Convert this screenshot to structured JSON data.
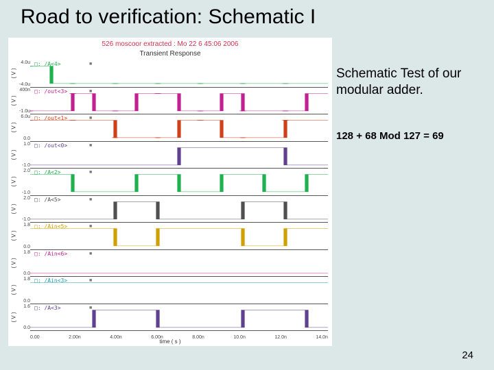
{
  "title": "Road to verification: Schematic I",
  "page_number": "24",
  "right": {
    "test_desc": "Schematic Test of our modular adder.",
    "equation": "128 + 68 Mod 127 = 69"
  },
  "plot": {
    "header": "526 moscoor extracted : Mo 22 6 45:06 2006",
    "subheader": "Transient Response",
    "xaxis_label": "time ( s )",
    "xticks": [
      "0.00",
      "2.00n",
      "4.00n",
      "6.00n",
      "8.00n",
      "10.0n",
      "12.0n",
      "14.0n"
    ],
    "ylabel_unit": "( V )",
    "traces": [
      {
        "name": "/A<4>",
        "color": "#20b050",
        "ytop": "4.0u",
        "ybot": "-4.0u",
        "levels": [
          1,
          0,
          0,
          0,
          0,
          0,
          0,
          0,
          0,
          0,
          0,
          0,
          0,
          0
        ],
        "dots": true
      },
      {
        "name": "/out<3>",
        "color": "#c02090",
        "ytop": "400n",
        "ybot": "-1.0u",
        "levels": [
          0,
          0,
          1,
          0,
          0,
          1,
          1,
          0,
          0,
          1,
          0,
          0,
          0,
          1
        ],
        "dots": true
      },
      {
        "name": "/out<1>",
        "color": "#d04018",
        "ytop": "6.0u",
        "ybot": "0.0",
        "levels": [
          1,
          1,
          1,
          1,
          0,
          0,
          0,
          1,
          1,
          0,
          0,
          0,
          1,
          1
        ],
        "dots": true
      },
      {
        "name": "/out<0>",
        "color": "#604090",
        "ytop": "1.0",
        "ybot": "-1.0",
        "levels": [
          0,
          0,
          0,
          0,
          0,
          0,
          0,
          1,
          1,
          1,
          1,
          1,
          0,
          0
        ],
        "dots": false
      },
      {
        "name": "/A<2>",
        "color": "#20b050",
        "ytop": "2.0",
        "ybot": "-1.0",
        "levels": [
          1,
          1,
          0,
          0,
          0,
          1,
          1,
          0,
          0,
          1,
          1,
          0,
          0,
          1
        ],
        "dots": false
      },
      {
        "name": "/A<5>",
        "color": "#505050",
        "ytop": "2.0",
        "ybot": "-1.0",
        "levels": [
          0,
          0,
          0,
          0,
          1,
          1,
          0,
          0,
          0,
          0,
          1,
          1,
          0,
          0
        ],
        "dots": false
      },
      {
        "name": "/Ain<5>",
        "color": "#d0a000",
        "ytop": "1.8",
        "ybot": "0.0",
        "levels": [
          1,
          1,
          1,
          1,
          0,
          0,
          1,
          1,
          1,
          1,
          0,
          0,
          1,
          1
        ],
        "dots": false
      },
      {
        "name": "/Ain<6>",
        "color": "#c02090",
        "ytop": "1.8",
        "ybot": "0.0",
        "levels": [
          0,
          0,
          0,
          0,
          0,
          0,
          0,
          0,
          0,
          0,
          0,
          0,
          0,
          0
        ],
        "dots": false
      },
      {
        "name": "/Ain<3>",
        "color": "#20a0b0",
        "ytop": "1.8",
        "ybot": "0.0",
        "levels": [
          1,
          1,
          1,
          1,
          1,
          1,
          1,
          1,
          1,
          1,
          1,
          1,
          1,
          1
        ],
        "dots": false
      },
      {
        "name": "/A<3>",
        "color": "#604090",
        "ytop": "1.6",
        "ybot": "0.0",
        "levels": [
          0,
          0,
          0,
          1,
          1,
          1,
          0,
          0,
          0,
          0,
          1,
          1,
          1,
          0
        ],
        "dots": false
      }
    ]
  },
  "chart_data": {
    "type": "line",
    "title": "Transient Response",
    "xlabel": "time (s)",
    "ylabel": "(V)",
    "x": [
      0.0,
      1e-09,
      2e-09,
      3e-09,
      4e-09,
      5e-09,
      6e-09,
      7e-09,
      8e-09,
      9e-09,
      1e-08,
      1.1e-08,
      1.2e-08,
      1.3e-08
    ],
    "xlim": [
      0.0,
      1.4e-08
    ],
    "series": [
      {
        "name": "/A<4>",
        "ylim": [
          -4e-06,
          4e-06
        ],
        "values": [
          1,
          0,
          0,
          0,
          0,
          0,
          0,
          0,
          0,
          0,
          0,
          0,
          0,
          0
        ]
      },
      {
        "name": "/out<3>",
        "ylim": [
          -1e-06,
          4e-07
        ],
        "values": [
          0,
          0,
          1,
          0,
          0,
          1,
          1,
          0,
          0,
          1,
          0,
          0,
          0,
          1
        ]
      },
      {
        "name": "/out<1>",
        "ylim": [
          0.0,
          6e-06
        ],
        "values": [
          1,
          1,
          1,
          1,
          0,
          0,
          0,
          1,
          1,
          0,
          0,
          0,
          1,
          1
        ]
      },
      {
        "name": "/out<0>",
        "ylim": [
          -1.0,
          1.0
        ],
        "values": [
          0,
          0,
          0,
          0,
          0,
          0,
          0,
          1,
          1,
          1,
          1,
          1,
          0,
          0
        ]
      },
      {
        "name": "/A<2>",
        "ylim": [
          -1.0,
          2.0
        ],
        "values": [
          1,
          1,
          0,
          0,
          0,
          1,
          1,
          0,
          0,
          1,
          1,
          0,
          0,
          1
        ]
      },
      {
        "name": "/A<5>",
        "ylim": [
          -1.0,
          2.0
        ],
        "values": [
          0,
          0,
          0,
          0,
          1,
          1,
          0,
          0,
          0,
          0,
          1,
          1,
          0,
          0
        ]
      },
      {
        "name": "/Ain<5>",
        "ylim": [
          0.0,
          1.8
        ],
        "values": [
          1,
          1,
          1,
          1,
          0,
          0,
          1,
          1,
          1,
          1,
          0,
          0,
          1,
          1
        ]
      },
      {
        "name": "/Ain<6>",
        "ylim": [
          0.0,
          1.8
        ],
        "values": [
          0,
          0,
          0,
          0,
          0,
          0,
          0,
          0,
          0,
          0,
          0,
          0,
          0,
          0
        ]
      },
      {
        "name": "/Ain<3>",
        "ylim": [
          0.0,
          1.8
        ],
        "values": [
          1,
          1,
          1,
          1,
          1,
          1,
          1,
          1,
          1,
          1,
          1,
          1,
          1,
          1
        ]
      },
      {
        "name": "/A<3>",
        "ylim": [
          0.0,
          1.6
        ],
        "values": [
          0,
          0,
          0,
          1,
          1,
          1,
          0,
          0,
          0,
          0,
          1,
          1,
          1,
          0
        ]
      }
    ]
  }
}
